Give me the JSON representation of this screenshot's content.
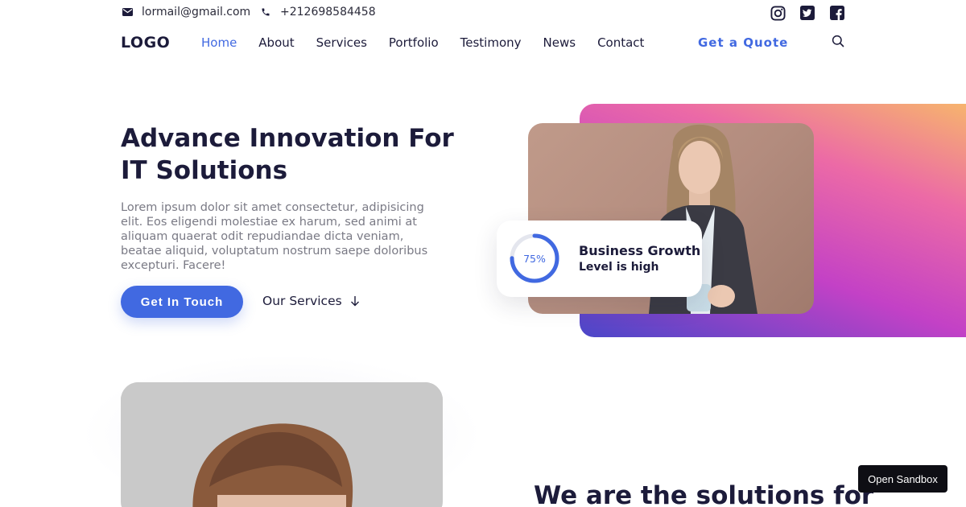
{
  "topbar": {
    "email": "lormail@gmail.com",
    "phone": "+212698584458",
    "social": [
      "instagram-icon",
      "twitter-icon",
      "facebook-icon"
    ]
  },
  "nav": {
    "logo": "LOGO",
    "links": [
      "Home",
      "About",
      "Services",
      "Portfolio",
      "Testimony",
      "News",
      "Contact"
    ],
    "active": "Home",
    "cta": "Get a Quote"
  },
  "hero": {
    "title": "Advance Innovation For IT Solutions",
    "text": "Lorem ipsum dolor sit amet consectetur, adipisicing elit. Eos eligendi molestiae ex harum, sed animi at aliquam quaerat odit repudiandae dicta veniam, beatae aliquid, voluptatum nostrum saepe doloribus excepturi. Facere!",
    "primary_button": "Get In Touch",
    "secondary_button": "Our Services"
  },
  "growth": {
    "progress": 75,
    "progress_label": "75%",
    "title": "Business Growth",
    "subtitle": "Level is high"
  },
  "section2": {
    "title": "We are the solutions for"
  },
  "sandbox_button": "Open Sandbox",
  "colors": {
    "accent": "#4169e1",
    "heading": "#1c1b3a",
    "body_text": "#7a7a85",
    "gradient": [
      "#f7b86a",
      "#ec6aa6",
      "#c341c6",
      "#4a47c8"
    ]
  }
}
